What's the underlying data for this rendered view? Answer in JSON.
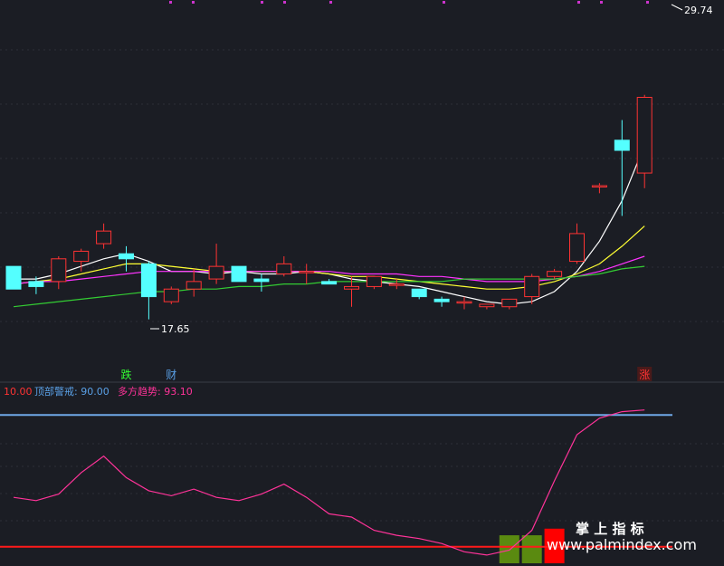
{
  "chart_data": [
    {
      "type": "candlestick",
      "max_label": "29.74",
      "min_label": "17.65",
      "ylim": [
        16.0,
        30.0
      ],
      "candles": [
        {
          "o": 19.8,
          "h": 19.8,
          "l": 18.9,
          "c": 18.9
        },
        {
          "o": 19.2,
          "h": 19.4,
          "l": 18.7,
          "c": 19.0
        },
        {
          "o": 19.2,
          "h": 20.2,
          "l": 18.9,
          "c": 20.1
        },
        {
          "o": 20.0,
          "h": 20.5,
          "l": 19.6,
          "c": 20.4
        },
        {
          "o": 20.7,
          "h": 21.5,
          "l": 20.5,
          "c": 21.2
        },
        {
          "o": 20.3,
          "h": 20.6,
          "l": 19.6,
          "c": 20.1
        },
        {
          "o": 19.9,
          "h": 20.0,
          "l": 17.7,
          "c": 18.6
        },
        {
          "o": 18.4,
          "h": 19.0,
          "l": 18.3,
          "c": 18.9
        },
        {
          "o": 18.9,
          "h": 19.7,
          "l": 18.6,
          "c": 19.2
        },
        {
          "o": 19.3,
          "h": 20.7,
          "l": 19.1,
          "c": 19.8
        },
        {
          "o": 19.8,
          "h": 19.8,
          "l": 19.3,
          "c": 19.2
        },
        {
          "o": 19.3,
          "h": 19.5,
          "l": 18.8,
          "c": 19.2
        },
        {
          "o": 19.5,
          "h": 20.2,
          "l": 19.4,
          "c": 19.9
        },
        {
          "o": 19.6,
          "h": 19.9,
          "l": 19.1,
          "c": 19.6
        },
        {
          "o": 19.2,
          "h": 19.3,
          "l": 19.1,
          "c": 19.1
        },
        {
          "o": 18.9,
          "h": 19.4,
          "l": 18.2,
          "c": 19.0
        },
        {
          "o": 19.0,
          "h": 19.4,
          "l": 18.9,
          "c": 19.4
        },
        {
          "o": 19.1,
          "h": 19.3,
          "l": 18.9,
          "c": 19.1
        },
        {
          "o": 18.9,
          "h": 18.9,
          "l": 18.5,
          "c": 18.6
        },
        {
          "o": 18.5,
          "h": 18.6,
          "l": 18.2,
          "c": 18.4
        },
        {
          "o": 18.4,
          "h": 18.6,
          "l": 18.1,
          "c": 18.4
        },
        {
          "o": 18.2,
          "h": 18.2,
          "l": 18.1,
          "c": 18.3
        },
        {
          "o": 18.2,
          "h": 18.4,
          "l": 18.1,
          "c": 18.5
        },
        {
          "o": 18.6,
          "h": 19.5,
          "l": 18.3,
          "c": 19.4
        },
        {
          "o": 19.4,
          "h": 19.7,
          "l": 19.3,
          "c": 19.6
        },
        {
          "o": 20.0,
          "h": 21.5,
          "l": 19.9,
          "c": 21.1
        },
        {
          "o": 23.0,
          "h": 23.1,
          "l": 22.7,
          "c": 23.0
        },
        {
          "o": 24.8,
          "h": 25.6,
          "l": 21.8,
          "c": 24.4
        },
        {
          "o": 23.5,
          "h": 26.6,
          "l": 22.9,
          "c": 26.5
        }
      ],
      "ma_lines": [
        {
          "color": "#ffffff",
          "values": [
            19.3,
            19.3,
            19.5,
            19.8,
            20.1,
            20.3,
            20.0,
            19.6,
            19.6,
            19.5,
            19.6,
            19.5,
            19.5,
            19.6,
            19.5,
            19.3,
            19.2,
            19.1,
            19.0,
            18.8,
            18.6,
            18.4,
            18.3,
            18.4,
            18.8,
            19.6,
            20.8,
            22.4,
            24.6
          ]
        },
        {
          "color": "#ffff33",
          "values": [
            19.1,
            19.2,
            19.3,
            19.5,
            19.7,
            19.9,
            19.9,
            19.8,
            19.7,
            19.6,
            19.6,
            19.6,
            19.6,
            19.6,
            19.5,
            19.4,
            19.4,
            19.3,
            19.2,
            19.1,
            19.0,
            18.9,
            18.9,
            19.0,
            19.2,
            19.5,
            19.9,
            20.6,
            21.4
          ]
        },
        {
          "color": "#ff33ff",
          "values": [
            19.1,
            19.2,
            19.2,
            19.3,
            19.4,
            19.5,
            19.6,
            19.6,
            19.6,
            19.6,
            19.6,
            19.6,
            19.6,
            19.6,
            19.6,
            19.5,
            19.5,
            19.5,
            19.4,
            19.4,
            19.3,
            19.2,
            19.2,
            19.2,
            19.3,
            19.4,
            19.6,
            19.9,
            20.2
          ]
        },
        {
          "color": "#33cc33",
          "values": [
            18.2,
            18.3,
            18.4,
            18.5,
            18.6,
            18.7,
            18.8,
            18.8,
            18.9,
            18.9,
            19.0,
            19.0,
            19.1,
            19.1,
            19.2,
            19.2,
            19.2,
            19.2,
            19.2,
            19.2,
            19.3,
            19.3,
            19.3,
            19.3,
            19.3,
            19.4,
            19.5,
            19.7,
            19.8
          ]
        }
      ]
    },
    {
      "type": "line",
      "legend": [
        {
          "label": "10.00",
          "color": "#ff3333"
        },
        {
          "label": "顶部警戒: 90.00",
          "color": "#5aa0e6"
        },
        {
          "label": "多方趋势: 93.10",
          "color": "#ff3399"
        }
      ],
      "ylim": [
        0,
        100
      ],
      "reference_lines": [
        {
          "value": 90,
          "color": "#6fa8e8"
        },
        {
          "value": 10,
          "color": "#ff1a1a"
        }
      ],
      "series": [
        {
          "color": "#ff3399",
          "values": [
            40,
            38,
            42,
            55,
            65,
            52,
            44,
            41,
            45,
            40,
            38,
            42,
            48,
            40,
            30,
            28,
            20,
            17,
            15,
            12,
            7,
            5,
            8,
            20,
            50,
            78,
            88,
            92,
            93
          ]
        }
      ],
      "histogram": [
        {
          "index": 22,
          "value": 17,
          "color": "#5a8a10"
        },
        {
          "index": 23,
          "value": 17,
          "color": "#5a8a10"
        },
        {
          "index": 24,
          "value": 21,
          "color": "#ff0000"
        }
      ]
    }
  ],
  "markers": [
    {
      "label": "跌",
      "index": 5,
      "color": "#33ff33"
    },
    {
      "label": "财",
      "index": 7,
      "color": "#5aa0e6"
    },
    {
      "label": "涨",
      "index": 28,
      "color": "#ff3333",
      "boxed": true
    }
  ],
  "watermark": {
    "title": "掌 上 指 标",
    "url": "www.palmindex.com"
  }
}
